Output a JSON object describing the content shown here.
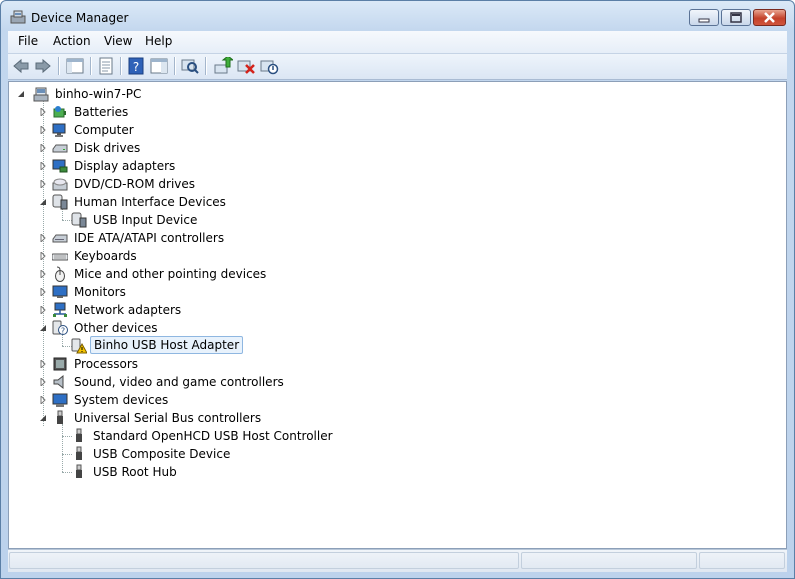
{
  "window": {
    "title": "Device Manager"
  },
  "menu": [
    "File",
    "Action",
    "View",
    "Help"
  ],
  "toolbar": {
    "buttons": [
      "back-arrow-icon",
      "forward-arrow-icon",
      "show-hide-tree-icon",
      "properties-icon",
      "help-icon",
      "action-pane-icon",
      "scan-hardware-icon",
      "update-driver-icon",
      "uninstall-icon",
      "disable-device-icon"
    ]
  },
  "tree": {
    "root": "binho-win7-PC",
    "categories": [
      {
        "label": "Batteries",
        "icon": "battery-icon",
        "expanded": false
      },
      {
        "label": "Computer",
        "icon": "computer-icon",
        "expanded": false
      },
      {
        "label": "Disk drives",
        "icon": "disk-drive-icon",
        "expanded": false
      },
      {
        "label": "Display adapters",
        "icon": "display-adapter-icon",
        "expanded": false
      },
      {
        "label": "DVD/CD-ROM drives",
        "icon": "dvd-drive-icon",
        "expanded": false
      },
      {
        "label": "Human Interface Devices",
        "icon": "hid-icon",
        "expanded": true,
        "children": [
          "USB Input Device"
        ]
      },
      {
        "label": "IDE ATA/ATAPI controllers",
        "icon": "ide-controller-icon",
        "expanded": false
      },
      {
        "label": "Keyboards",
        "icon": "keyboard-icon",
        "expanded": false
      },
      {
        "label": "Mice and other pointing devices",
        "icon": "mouse-icon",
        "expanded": false
      },
      {
        "label": "Monitors",
        "icon": "monitor-icon",
        "expanded": false
      },
      {
        "label": "Network adapters",
        "icon": "network-adapter-icon",
        "expanded": false
      },
      {
        "label": "Other devices",
        "icon": "other-devices-icon",
        "expanded": true,
        "children": [
          "Binho USB Host Adapter"
        ]
      },
      {
        "label": "Processors",
        "icon": "processor-icon",
        "expanded": false
      },
      {
        "label": "Sound, video and game controllers",
        "icon": "speaker-icon",
        "expanded": false
      },
      {
        "label": "System devices",
        "icon": "system-device-icon",
        "expanded": false
      },
      {
        "label": "Universal Serial Bus controllers",
        "icon": "usb-icon",
        "expanded": true,
        "children": [
          "Standard OpenHCD USB Host Controller",
          "USB Composite Device",
          "USB Root Hub"
        ]
      }
    ],
    "selected": "Binho USB Host Adapter"
  },
  "colors": {
    "selection": "#e8f2fc",
    "selection_border": "#8fb7e1",
    "warning": "#f5c400"
  }
}
